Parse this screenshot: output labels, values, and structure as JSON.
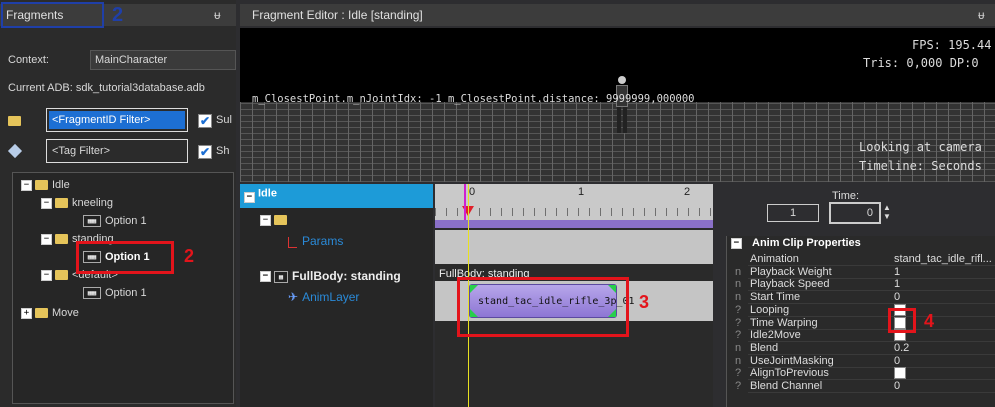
{
  "fragments_panel": {
    "title": "Fragments",
    "pin": "ᵾ",
    "context_label": "Context:",
    "context_value": "MainCharacter",
    "current_adb": "Current ADB: sdk_tutorial3database.adb",
    "fragment_filter": "<FragmentID Filter>",
    "sub_label": "Sul",
    "tag_filter": "<Tag Filter>",
    "sho_label": "Sh",
    "tree": {
      "idle": "Idle",
      "kneeling": "kneeling",
      "kneeling_option": "Option 1",
      "standing": "standing",
      "standing_option": "Option 1",
      "default": "<default>",
      "default_option": "Option 1",
      "move": "Move"
    }
  },
  "editor": {
    "title": "Fragment Editor : Idle [standing]",
    "pin": "ᵾ",
    "fps": "FPS: 195.44",
    "tris": "Tris: 0,000  DP:0",
    "debug_text": "m_ClosestPoint.m_nJointIdx: -1  m_ClosestPoint.distance: 9999999,000000",
    "looking": "Looking at camera",
    "timeline_label": "Timeline: Seconds"
  },
  "sequence": {
    "idle": "Idle",
    "params": "Params",
    "fullbody": "FullBody: standing",
    "anim_layer": "AnimLayer",
    "track_label": "FullBody: standing",
    "clip": "stand_tac_idle_rifle_3p_01",
    "ruler": [
      "0",
      "1",
      "2"
    ]
  },
  "time": {
    "label": "Time:",
    "value1": "1",
    "value2": "0"
  },
  "properties": {
    "header": "Anim Clip Properties",
    "rows": [
      {
        "flag": "",
        "name": "Animation",
        "value": "stand_tac_idle_rifl..."
      },
      {
        "flag": "n",
        "name": "Playback Weight",
        "value": "1"
      },
      {
        "flag": "n",
        "name": "Playback Speed",
        "value": "1"
      },
      {
        "flag": "n",
        "name": "Start Time",
        "value": "0"
      },
      {
        "flag": "?",
        "name": "Looping",
        "value": ""
      },
      {
        "flag": "?",
        "name": "Time Warping",
        "value": ""
      },
      {
        "flag": "?",
        "name": "Idle2Move",
        "value": ""
      },
      {
        "flag": "n",
        "name": "Blend",
        "value": "0.2"
      },
      {
        "flag": "n",
        "name": "UseJointMasking",
        "value": "0"
      },
      {
        "flag": "?",
        "name": "AlignToPrevious",
        "value": ""
      },
      {
        "flag": "?",
        "name": "Blend Channel",
        "value": "0"
      }
    ]
  },
  "annotations": {
    "m1": "2",
    "m2": "2",
    "m3": "3",
    "m4": "4",
    "color": "#e3141b",
    "blue": "#1f3fa8"
  }
}
